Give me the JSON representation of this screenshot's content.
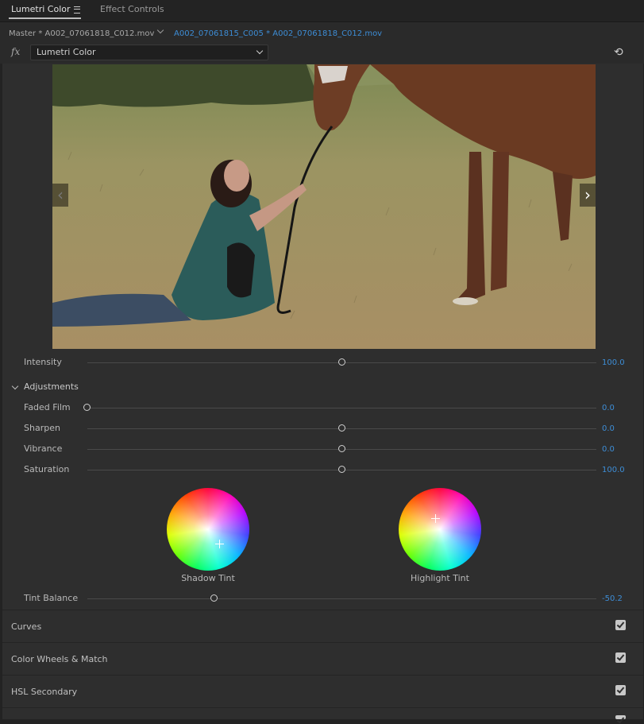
{
  "tabs": [
    {
      "label": "Lumetri Color",
      "active": true
    },
    {
      "label": "Effect Controls",
      "active": false
    }
  ],
  "clip_bar": {
    "master_label": "Master * A002_07061818_C012.mov",
    "active_clip": "A002_07061815_C005 * A002_07061818_C012.mov"
  },
  "fx_row": {
    "fx_label": "fx",
    "effect_select": "Lumetri Color",
    "reset_icon": "reset-icon"
  },
  "intensity": {
    "label": "Intensity",
    "value": "100.0",
    "fraction": 0.5
  },
  "adjustments": {
    "title": "Adjustments",
    "sliders": [
      {
        "label": "Faded Film",
        "value": "0.0",
        "fraction": 0.0
      },
      {
        "label": "Sharpen",
        "value": "0.0",
        "fraction": 0.5
      },
      {
        "label": "Vibrance",
        "value": "0.0",
        "fraction": 0.5
      },
      {
        "label": "Saturation",
        "value": "100.0",
        "fraction": 0.5
      }
    ],
    "wheels": [
      {
        "label": "Shadow Tint"
      },
      {
        "label": "Highlight Tint"
      }
    ],
    "tint_balance": {
      "label": "Tint Balance",
      "value": "-50.2",
      "fraction": 0.25
    }
  },
  "collapsed_sections": [
    {
      "label": "Curves",
      "checked": true
    },
    {
      "label": "Color Wheels & Match",
      "checked": true
    },
    {
      "label": "HSL Secondary",
      "checked": true
    }
  ],
  "colors": {
    "accent_value": "#3d8dd6",
    "panel_bg": "#2e2e2e",
    "annotation_red": "#ff0000"
  }
}
